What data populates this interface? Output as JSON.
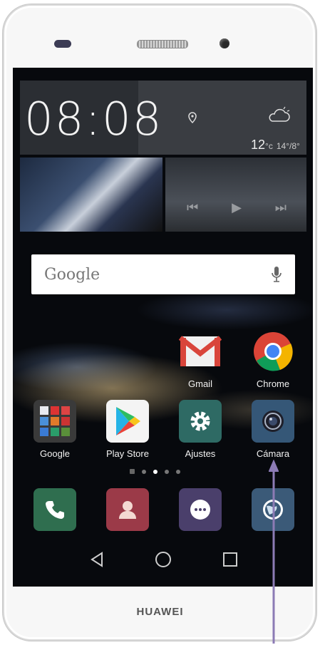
{
  "clock": {
    "time": "08:08",
    "temp": "12",
    "temp_unit": "°c",
    "range": "14°/8°"
  },
  "search": {
    "logo": "Google"
  },
  "row1": [
    {
      "label": "Gmail",
      "icon": "gmail-icon"
    },
    {
      "label": "Chrome",
      "icon": "chrome-icon"
    }
  ],
  "row2": [
    {
      "label": "Google",
      "icon": "google-folder-icon"
    },
    {
      "label": "Play Store",
      "icon": "play-store-icon"
    },
    {
      "label": "Ajustes",
      "icon": "settings-icon"
    },
    {
      "label": "Cámara",
      "icon": "camera-icon"
    }
  ],
  "dock": [
    {
      "icon": "phone-icon",
      "color": "#2f6e4f"
    },
    {
      "icon": "contacts-icon",
      "color": "#9b3a48"
    },
    {
      "icon": "messages-icon",
      "color": "#4a3f6b"
    },
    {
      "icon": "browser-icon",
      "color": "#3b5a78"
    }
  ],
  "brand": "HUAWEI",
  "colors": {
    "arrow": "#8c7bb5",
    "accent_blue": "#355777"
  }
}
